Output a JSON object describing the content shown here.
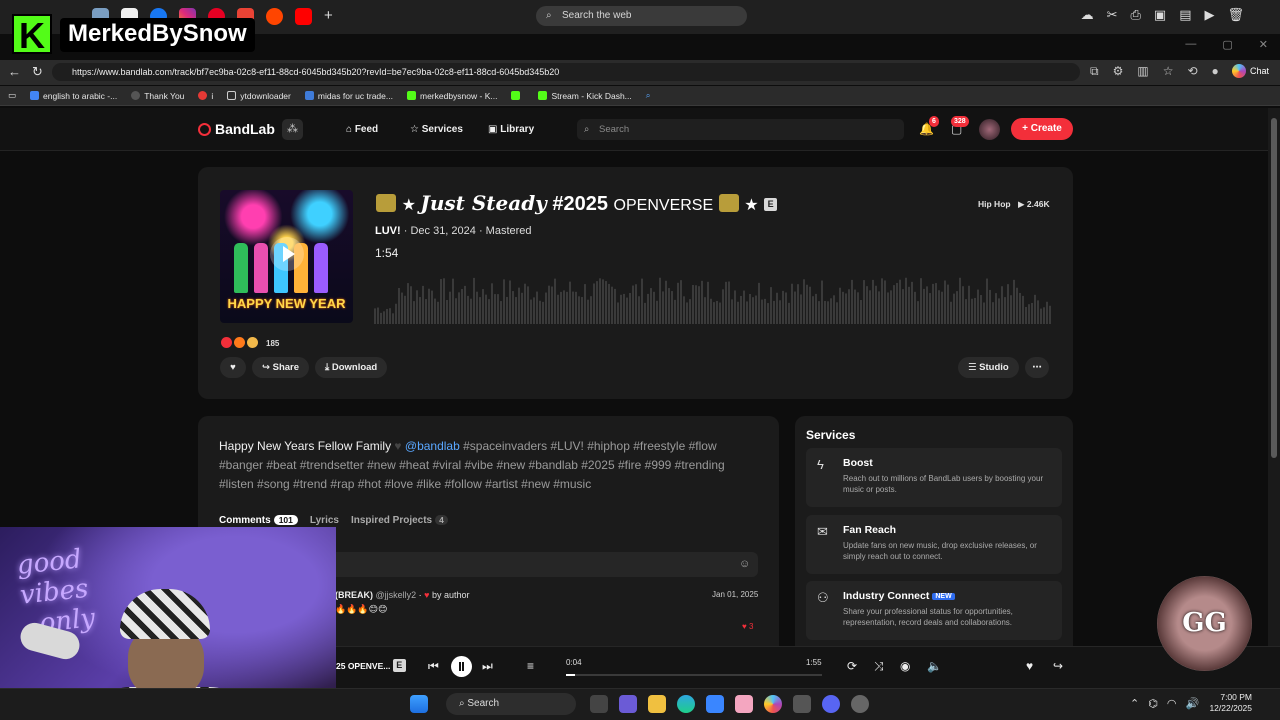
{
  "overlay": {
    "streamer_name": "MerkedBySnow"
  },
  "browser": {
    "web_search_placeholder": "Search the web",
    "url": "https://www.bandlab.com/track/bf7ec9ba-02c8-ef11-88cd-6045bd345b20?revId=be7ec9ba-02c8-ef11-88cd-6045bd345b20",
    "chat_label": "Chat",
    "favorites": [
      "english to arabic -...",
      "Thank You",
      "i",
      "ytdownloader",
      "midas for uc trade...",
      "merkedbysnow - K...",
      "",
      "Stream - Kick Dash..."
    ]
  },
  "header": {
    "logo": "BandLab",
    "nav": [
      "Feed",
      "Services",
      "Library"
    ],
    "search_placeholder": "Search",
    "notif_count": "6",
    "msg_count": "328",
    "create_label": "Create"
  },
  "track": {
    "title_script": "Just Steady",
    "title_bold": "#2025",
    "title_small": "OPENVERSE",
    "explicit": "E",
    "artist": "LUV!",
    "date": "Dec 31, 2024",
    "status": "Mastered",
    "duration": "1:54",
    "genre": "Hip Hop",
    "plays": "2.46K",
    "cover_text": "HAPPY NEW YEAR",
    "reactions": "185",
    "actions": {
      "share": "Share",
      "download": "Download",
      "studio": "Studio"
    }
  },
  "description": {
    "text": "Happy New Years Fellow Family",
    "mention": "@bandlab",
    "tags_line1": "#spaceinvaders #LUV! #hiphop #freestyle #flow",
    "tags_line2": "#banger #beat #trendsetter #new #heat #viral #vibe #new #bandlab #2025 #fire #999 #trending",
    "tags_line3": "#listen #song #trend #rap #hot #love #like #follow #artist #new #music"
  },
  "tabs": {
    "comments": "Comments",
    "comments_count": "101",
    "lyrics": "Lyrics",
    "inspired": "Inspired Projects",
    "inspired_count": "4"
  },
  "comment": {
    "user": "(BREAK)",
    "handle": "@jjskelly2",
    "by": "by author",
    "date": "Jan 01, 2025",
    "likes": "3"
  },
  "services": {
    "title": "Services",
    "items": [
      {
        "name": "Boost",
        "desc": "Reach out to millions of BandLab users by boosting your music or posts."
      },
      {
        "name": "Fan Reach",
        "desc": "Update fans on new music, drop exclusive releases, or simply reach out to connect."
      },
      {
        "name": "Industry Connect",
        "tag": "NEW",
        "desc": "Share your professional status for opportunities, representation, record deals and collaborations."
      }
    ]
  },
  "player": {
    "track": "25 OPENVE...",
    "current": "0:04",
    "total": "1:55",
    "progress": 0.035
  },
  "team_logo": "GG",
  "taskbar": {
    "search": "Search",
    "time": "7:00 PM",
    "date": "12/22/2025"
  }
}
